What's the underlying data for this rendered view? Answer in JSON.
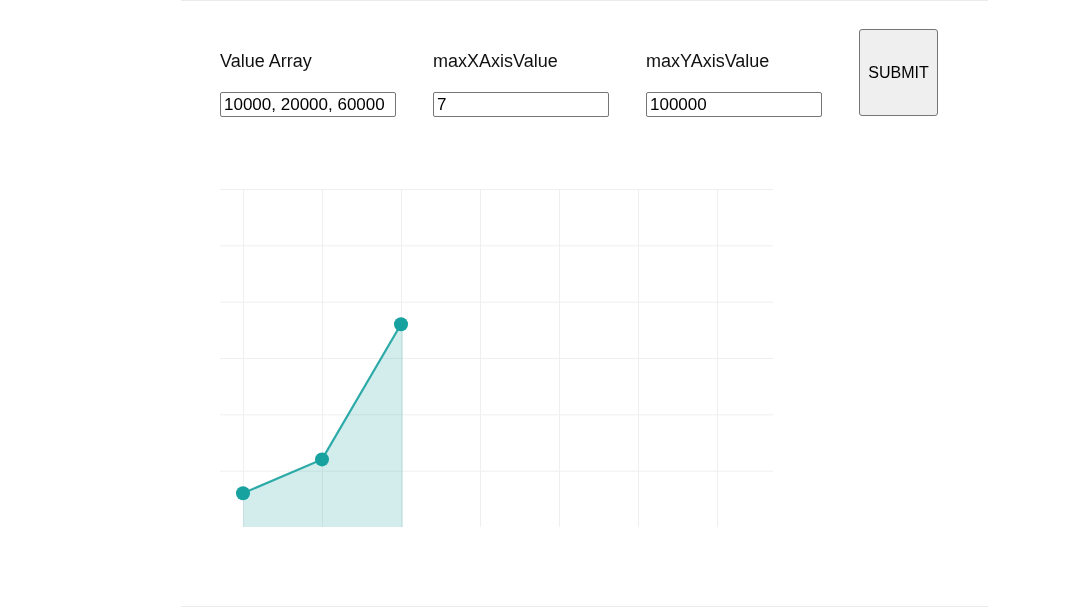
{
  "form": {
    "fields": [
      {
        "label": "Value Array",
        "value": "10000, 20000, 60000"
      },
      {
        "label": "maxXAxisValue",
        "value": "7"
      },
      {
        "label": "maxYAxisValue",
        "value": "100000"
      }
    ],
    "submit_button": "SUBMIT"
  }
}
